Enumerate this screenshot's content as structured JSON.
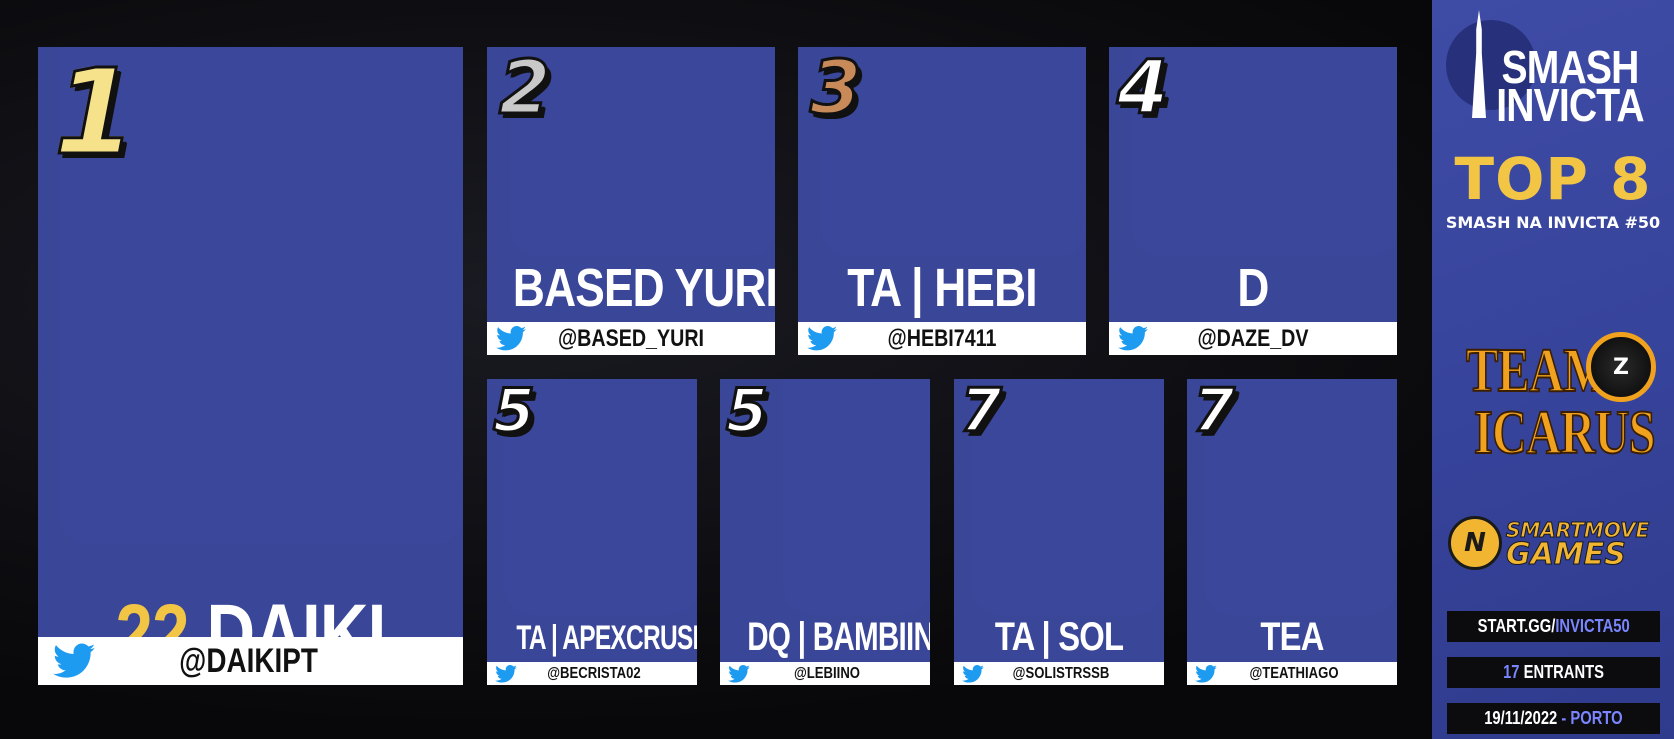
{
  "players": [
    {
      "rank": "1",
      "seed": "22",
      "name": "DAIKI",
      "handle": "@DAIKIPT",
      "rank_style": "gold"
    },
    {
      "rank": "2",
      "seed": "",
      "name": "BASED YURI",
      "handle": "@BASED_YURI",
      "rank_style": "silver"
    },
    {
      "rank": "3",
      "seed": "",
      "name": "TA | HEBI",
      "handle": "@HEBI7411",
      "rank_style": "bronze"
    },
    {
      "rank": "4",
      "seed": "",
      "name": "D",
      "handle": "@DAZE_DV",
      "rank_style": "white"
    },
    {
      "rank": "5",
      "seed": "",
      "name": "TA | APEXCRUSHER",
      "handle": "@BECRISTA02",
      "rank_style": "white"
    },
    {
      "rank": "5",
      "seed": "",
      "name": "DQ | BAMBIINO",
      "handle": "@LEBIINO",
      "rank_style": "white"
    },
    {
      "rank": "7",
      "seed": "",
      "name": "TA | SOL",
      "handle": "@SOLISTRSSB",
      "rank_style": "white"
    },
    {
      "rank": "7",
      "seed": "",
      "name": "TEA",
      "handle": "@TEATHIAGO",
      "rank_style": "white"
    }
  ],
  "sidebar": {
    "brand_line1": "SMASH",
    "brand_line2": "INVICTA",
    "top8": "TOP 8",
    "event_name": "SMASH NA INVICTA #50",
    "sponsor1_line1": "TEAM",
    "sponsor1_line2": "ICARUS",
    "sponsor1_mark": "Z",
    "sponsor2_mark": "N",
    "sponsor2_line1": "SMARTMOVE",
    "sponsor2_line2": "GAMES",
    "url_prefix": "START.GG/",
    "url_suffix": "INVICTA50",
    "entrants_count": "17",
    "entrants_label": " ENTRANTS",
    "date": "19/11/2022",
    "date_sep": " - ",
    "location": "PORTO"
  },
  "colors": {
    "card_bg": "#3a4697",
    "sidebar_bg": "#3b48a0",
    "seed_gold": "#f3c544",
    "accent": "#7a86ff",
    "twitter_blue": "#1d9bf0"
  }
}
